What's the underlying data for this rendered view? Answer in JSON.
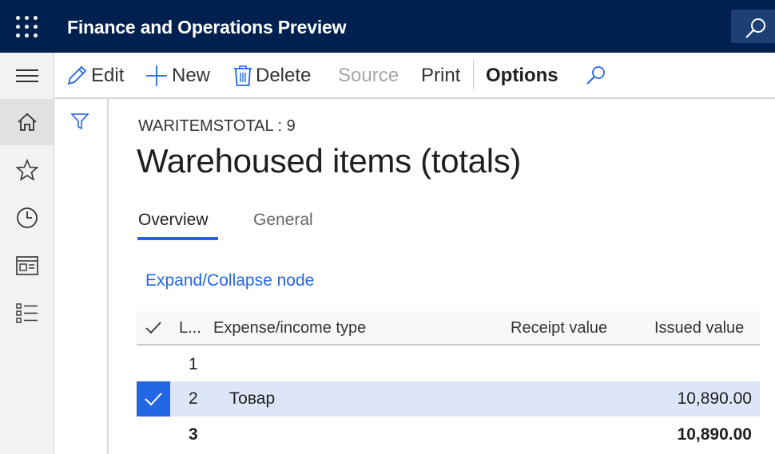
{
  "app": {
    "title": "Finance and Operations Preview"
  },
  "actions": {
    "edit": "Edit",
    "new": "New",
    "delete": "Delete",
    "source": "Source",
    "print": "Print",
    "options": "Options"
  },
  "nav": {
    "items": [
      "home-icon",
      "star-icon",
      "clock-icon",
      "workspace-icon",
      "list-icon"
    ]
  },
  "form": {
    "caption": "WARITEMSTOTAL : 9",
    "title": "Warehoused items (totals)",
    "tabs": [
      {
        "label": "Overview",
        "selected": true
      },
      {
        "label": "General",
        "selected": false
      }
    ],
    "expand_link": "Expand/Collapse node"
  },
  "grid": {
    "columns": [
      "L...",
      "Expense/income type",
      "Receipt value",
      "Issued value"
    ],
    "rows": [
      {
        "level": "1",
        "type": "",
        "receipt": "",
        "issued": "",
        "selected": false,
        "bold": false
      },
      {
        "level": "2",
        "type": "Товар",
        "receipt": "",
        "issued": "10,890.00",
        "selected": true,
        "bold": false
      },
      {
        "level": "3",
        "type": "",
        "receipt": "",
        "issued": "10,890.00",
        "selected": false,
        "bold": true
      }
    ]
  },
  "colors": {
    "topbar": "#002050",
    "accent": "#2266e3",
    "selected_row": "#dde6f8"
  }
}
